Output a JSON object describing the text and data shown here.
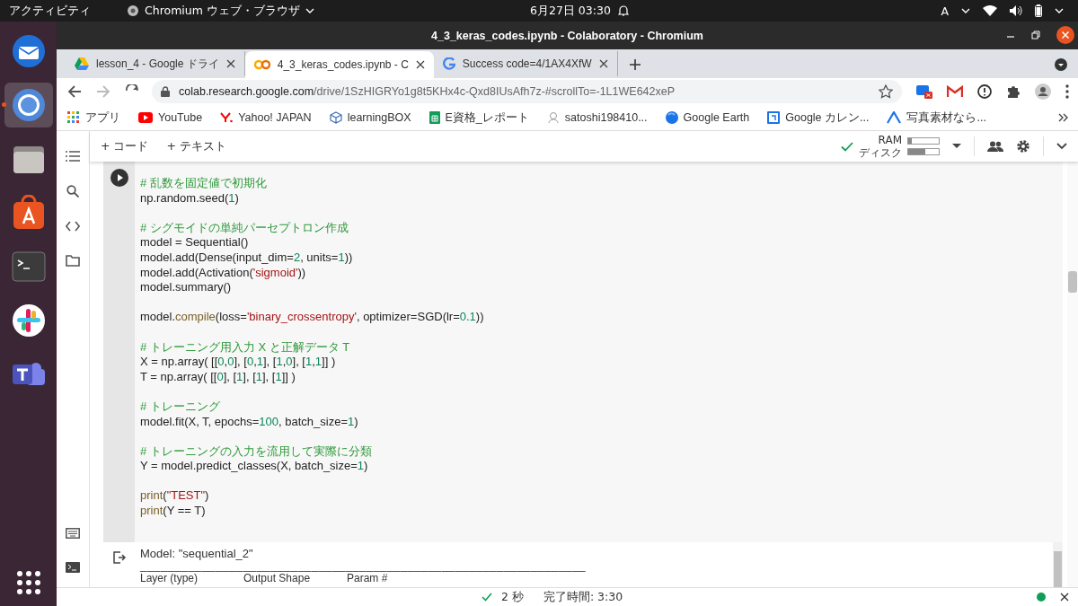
{
  "topbar": {
    "activities": "アクティビティ",
    "app_menu": "Chromium ウェブ・ブラウザ",
    "clock": "6月27日 03:30",
    "input_method": "A"
  },
  "dock": [
    {
      "kind": "mail",
      "selected": false
    },
    {
      "kind": "browser",
      "selected": true
    },
    {
      "kind": "files",
      "selected": false
    },
    {
      "kind": "store",
      "selected": false
    },
    {
      "kind": "terminal",
      "selected": false
    },
    {
      "kind": "chat",
      "selected": false
    },
    {
      "kind": "teams",
      "selected": false
    }
  ],
  "window": {
    "title": "4_3_keras_codes.ipynb - Colaboratory - Chromium"
  },
  "tabs": [
    {
      "label": "lesson_4 - Google ドライ",
      "kind": "drive",
      "selected": false
    },
    {
      "label": "4_3_keras_codes.ipynb - C",
      "kind": "colab",
      "selected": true
    },
    {
      "label": "Success code=4/1AX4XfW",
      "kind": "google",
      "selected": false
    }
  ],
  "address": {
    "host": "colab.research.google.com",
    "path": "/drive/1SzHIGRYo1g8t5KHx4c-Qxd8IUsAfh7z-#scrollTo=-1L1WE642xeP"
  },
  "bookmarks": [
    {
      "label": "アプリ",
      "kind": "apps"
    },
    {
      "label": "YouTube",
      "kind": "youtube"
    },
    {
      "label": "Yahoo! JAPAN",
      "kind": "yahoo"
    },
    {
      "label": "learningBOX",
      "kind": "cube"
    },
    {
      "label": "E資格_レポート",
      "kind": "sheet"
    },
    {
      "label": "satoshi198410...",
      "kind": "user"
    },
    {
      "label": "Google Earth",
      "kind": "globe"
    },
    {
      "label": "Google カレン...",
      "kind": "calendar"
    },
    {
      "label": "写真素材なら...",
      "kind": "triangle"
    }
  ],
  "notebook_toolbar": {
    "add_code": "+ コード",
    "add_text": "+ テキスト",
    "connected": true,
    "ram": {
      "label": "RAM",
      "level": 0.12
    },
    "disk": {
      "label": "ディスク",
      "level": 0.55
    }
  },
  "code_cell": {
    "blocks": [
      [
        [
          {
            "t": "# 乱数を固定値で初期化",
            "kind": "comment"
          }
        ],
        [
          {
            "t": "np.random.seed(",
            "kind": "plain"
          },
          {
            "t": "1",
            "kind": "number"
          },
          {
            "t": ")",
            "kind": "plain"
          }
        ]
      ],
      [
        [
          {
            "t": "# シグモイドの単純パーセプトロン作成",
            "kind": "comment"
          }
        ],
        [
          {
            "t": "model = Sequential()",
            "kind": "plain"
          }
        ],
        [
          {
            "t": "model.add(Dense(input_dim=",
            "kind": "plain"
          },
          {
            "t": "2",
            "kind": "number"
          },
          {
            "t": ", units=",
            "kind": "plain"
          },
          {
            "t": "1",
            "kind": "number"
          },
          {
            "t": "))",
            "kind": "plain"
          }
        ],
        [
          {
            "t": "model.add(Activation(",
            "kind": "plain"
          },
          {
            "t": "'sigmoid'",
            "kind": "string"
          },
          {
            "t": "))",
            "kind": "plain"
          }
        ],
        [
          {
            "t": "model.summary()",
            "kind": "plain"
          }
        ]
      ],
      [
        [
          {
            "t": "model.",
            "kind": "plain"
          },
          {
            "t": "compile",
            "kind": "function"
          },
          {
            "t": "(loss=",
            "kind": "plain"
          },
          {
            "t": "'binary_crossentropy'",
            "kind": "string"
          },
          {
            "t": ", optimizer=SGD(lr=",
            "kind": "plain"
          },
          {
            "t": "0.1",
            "kind": "number"
          },
          {
            "t": "))",
            "kind": "plain"
          }
        ]
      ],
      [
        [
          {
            "t": "# トレーニング用入力 X と正解データ T",
            "kind": "comment"
          }
        ],
        [
          {
            "t": "X = np.array( [[",
            "kind": "plain"
          },
          {
            "t": "0",
            "kind": "number"
          },
          {
            "t": ",",
            "kind": "plain"
          },
          {
            "t": "0",
            "kind": "number"
          },
          {
            "t": "], [",
            "kind": "plain"
          },
          {
            "t": "0",
            "kind": "number"
          },
          {
            "t": ",",
            "kind": "plain"
          },
          {
            "t": "1",
            "kind": "number"
          },
          {
            "t": "], [",
            "kind": "plain"
          },
          {
            "t": "1",
            "kind": "number"
          },
          {
            "t": ",",
            "kind": "plain"
          },
          {
            "t": "0",
            "kind": "number"
          },
          {
            "t": "], [",
            "kind": "plain"
          },
          {
            "t": "1",
            "kind": "number"
          },
          {
            "t": ",",
            "kind": "plain"
          },
          {
            "t": "1",
            "kind": "number"
          },
          {
            "t": "]] )",
            "kind": "plain"
          }
        ],
        [
          {
            "t": "T = np.array( [[",
            "kind": "plain"
          },
          {
            "t": "0",
            "kind": "number"
          },
          {
            "t": "], [",
            "kind": "plain"
          },
          {
            "t": "1",
            "kind": "number"
          },
          {
            "t": "], [",
            "kind": "plain"
          },
          {
            "t": "1",
            "kind": "number"
          },
          {
            "t": "], [",
            "kind": "plain"
          },
          {
            "t": "1",
            "kind": "number"
          },
          {
            "t": "]] )",
            "kind": "plain"
          }
        ]
      ],
      [
        [
          {
            "t": "# トレーニング",
            "kind": "comment"
          }
        ],
        [
          {
            "t": "model.fit(X, T, epochs=",
            "kind": "plain"
          },
          {
            "t": "100",
            "kind": "number"
          },
          {
            "t": ", batch_size=",
            "kind": "plain"
          },
          {
            "t": "1",
            "kind": "number"
          },
          {
            "t": ")",
            "kind": "plain"
          }
        ]
      ],
      [
        [
          {
            "t": "# トレーニングの入力を流用して実際に分類",
            "kind": "comment"
          }
        ],
        [
          {
            "t": "Y = model.predict_classes(X, batch_size=",
            "kind": "plain"
          },
          {
            "t": "1",
            "kind": "number"
          },
          {
            "t": ")",
            "kind": "plain"
          }
        ]
      ],
      [
        [
          {
            "t": "print",
            "kind": "function"
          },
          {
            "t": "(",
            "kind": "plain"
          },
          {
            "t": "\"TEST\"",
            "kind": "string"
          },
          {
            "t": ")",
            "kind": "plain"
          }
        ],
        [
          {
            "t": "print",
            "kind": "function"
          },
          {
            "t": "(Y == T)",
            "kind": "plain"
          }
        ]
      ]
    ]
  },
  "output": {
    "title": "Model: \"sequential_2\"",
    "rule": "_________________________________________________________________",
    "columns": [
      "Layer (type)",
      "Output Shape",
      "Param #"
    ]
  },
  "status_bar": {
    "duration": "2 秒",
    "completed": "完了時間: 3:30",
    "connected": true
  }
}
